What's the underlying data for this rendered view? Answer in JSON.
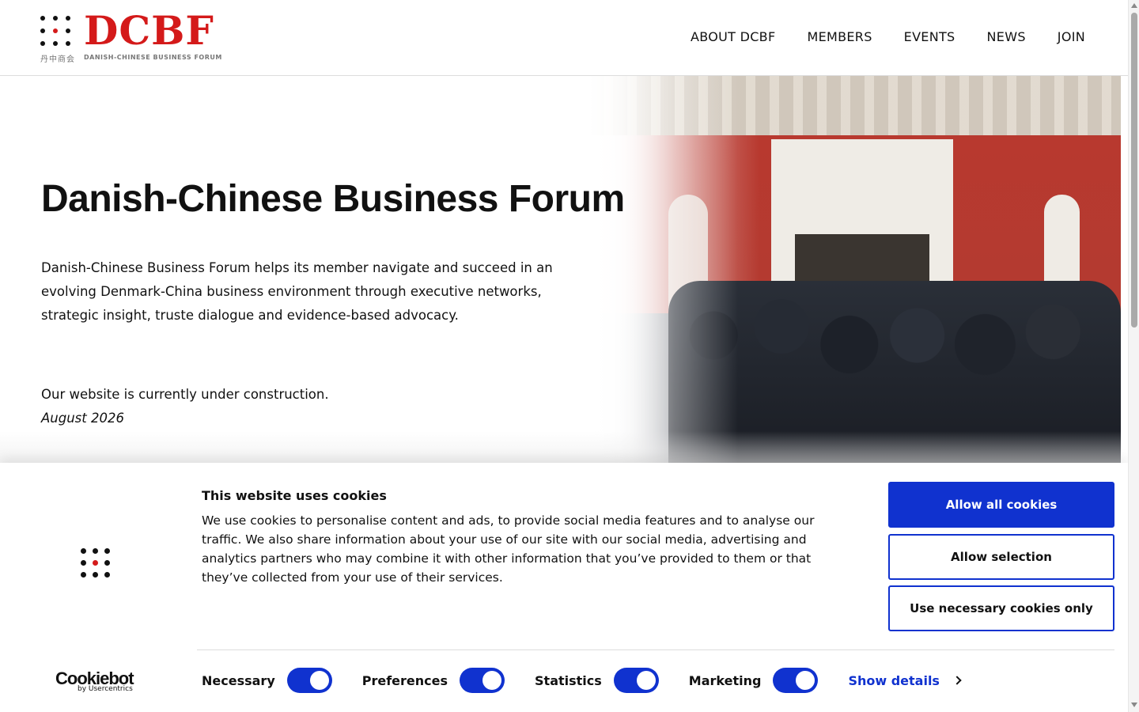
{
  "logo": {
    "mark": "DCBF",
    "subtitle": "DANISH-CHINESE BUSINESS FORUM",
    "chinese": "丹中商会"
  },
  "nav": {
    "items": [
      {
        "label": "ABOUT DCBF"
      },
      {
        "label": "MEMBERS"
      },
      {
        "label": "EVENTS"
      },
      {
        "label": "NEWS"
      },
      {
        "label": "JOIN"
      }
    ]
  },
  "hero": {
    "title": "Danish-Chinese Business Forum",
    "description": "Danish-Chinese Business Forum helps its member navigate and succeed in an evolving Denmark-China business environment through executive networks, strategic insight, truste dialogue and evidence-based advocacy.",
    "note": "Our website is currently under construction.",
    "date": "August 2026",
    "image": "reception-crowd-photo"
  },
  "cookie_banner": {
    "title": "This website uses cookies",
    "text": "We use cookies to personalise content and ads, to provide social media features and to analyse our traffic. We also share information about your use of our site with our social media, advertising and analytics partners who may combine it with other information that you’ve provided to them or that they’ve collected from your use of their services.",
    "buttons": {
      "allow_all": "Allow all cookies",
      "allow_selection": "Allow selection",
      "necessary_only": "Use necessary cookies only"
    },
    "toggles": [
      {
        "label": "Necessary",
        "on": true
      },
      {
        "label": "Preferences",
        "on": true
      },
      {
        "label": "Statistics",
        "on": true
      },
      {
        "label": "Marketing",
        "on": true
      }
    ],
    "show_details": "Show details",
    "brand": "Cookiebot",
    "brand_sub": "by Usercentrics"
  },
  "colors": {
    "brand_red": "#d41a1a",
    "accent_blue": "#1032cf"
  }
}
